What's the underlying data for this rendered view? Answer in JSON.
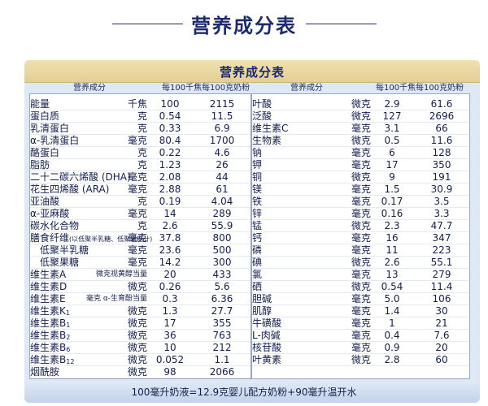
{
  "page_title": "营养成分表",
  "panel_title": "营养成分表",
  "columns": {
    "nutrient": "营养成分",
    "per_100kj": "每100千焦",
    "per_100g": "每100克奶粉"
  },
  "left_rows": [
    {
      "name": "能量",
      "unit": "千焦",
      "a": "100",
      "b": "2115"
    },
    {
      "name": "蛋白质",
      "unit": "克",
      "a": "0.54",
      "b": "11.5"
    },
    {
      "name": "乳清蛋白",
      "unit": "克",
      "a": "0.33",
      "b": "6.9"
    },
    {
      "name": "α-乳清蛋白",
      "unit": "毫克",
      "a": "80.4",
      "b": "1700"
    },
    {
      "name": "酪蛋白",
      "unit": "克",
      "a": "0.22",
      "b": "4.6"
    },
    {
      "name": "脂肪",
      "unit": "克",
      "a": "1.23",
      "b": "26"
    },
    {
      "name": "二十二碳六烯酸 (DHA)",
      "unit": "毫克",
      "a": "2.08",
      "b": "44"
    },
    {
      "name": "花生四烯酸 (ARA)",
      "unit": "毫克",
      "a": "2.88",
      "b": "61"
    },
    {
      "name": "亚油酸",
      "unit": "克",
      "a": "0.19",
      "b": "4.04"
    },
    {
      "name": "α-亚麻酸",
      "unit": "毫克",
      "a": "14",
      "b": "289"
    },
    {
      "name": "碳水化合物",
      "unit": "克",
      "a": "2.6",
      "b": "55.9"
    },
    {
      "name": "膳食纤维",
      "name_note": "(以低聚半乳糖、低聚果糖计)",
      "unit": "毫克",
      "a": "37.8",
      "b": "800"
    },
    {
      "name": "低聚半乳糖",
      "unit": "毫克",
      "a": "23.6",
      "b": "500",
      "indent": true
    },
    {
      "name": "低聚果糖",
      "unit": "毫克",
      "a": "14.2",
      "b": "300",
      "indent": true
    },
    {
      "name": "维生素A",
      "unit": "微克视黄醇当量",
      "a": "20",
      "b": "433"
    },
    {
      "name": "维生素D",
      "unit": "微克",
      "a": "0.26",
      "b": "5.6"
    },
    {
      "name": "维生素E",
      "unit": "毫克 α-生育酚当量",
      "a": "0.3",
      "b": "6.36"
    },
    {
      "name": "维生素K",
      "sub": "1",
      "unit": "微克",
      "a": "1.3",
      "b": "27.7"
    },
    {
      "name": "维生素B",
      "sub": "1",
      "unit": "微克",
      "a": "17",
      "b": "355"
    },
    {
      "name": "维生素B",
      "sub": "2",
      "unit": "微克",
      "a": "36",
      "b": "763"
    },
    {
      "name": "维生素B",
      "sub": "6",
      "unit": "微克",
      "a": "10",
      "b": "212"
    },
    {
      "name": "维生素B",
      "sub": "12",
      "unit": "微克",
      "a": "0.052",
      "b": "1.1"
    },
    {
      "name": "烟酰胺",
      "unit": "微克",
      "a": "98",
      "b": "2066"
    }
  ],
  "right_rows": [
    {
      "name": "叶酸",
      "unit": "微克",
      "a": "2.9",
      "b": "61.6"
    },
    {
      "name": "泛酸",
      "unit": "微克",
      "a": "127",
      "b": "2696"
    },
    {
      "name": "维生素C",
      "unit": "毫克",
      "a": "3.1",
      "b": "66"
    },
    {
      "name": "生物素",
      "unit": "微克",
      "a": "0.5",
      "b": "11.6"
    },
    {
      "name": "钠",
      "unit": "毫克",
      "a": "6",
      "b": "128"
    },
    {
      "name": "钾",
      "unit": "毫克",
      "a": "17",
      "b": "350"
    },
    {
      "name": "铜",
      "unit": "微克",
      "a": "9",
      "b": "191"
    },
    {
      "name": "镁",
      "unit": "毫克",
      "a": "1.5",
      "b": "30.9"
    },
    {
      "name": "铁",
      "unit": "毫克",
      "a": "0.17",
      "b": "3.5"
    },
    {
      "name": "锌",
      "unit": "毫克",
      "a": "0.16",
      "b": "3.3"
    },
    {
      "name": "锰",
      "unit": "微克",
      "a": "2.3",
      "b": "47.7"
    },
    {
      "name": "钙",
      "unit": "毫克",
      "a": "16",
      "b": "347"
    },
    {
      "name": "磷",
      "unit": "毫克",
      "a": "11",
      "b": "223"
    },
    {
      "name": "碘",
      "unit": "微克",
      "a": "2.6",
      "b": "55.1"
    },
    {
      "name": "氯",
      "unit": "毫克",
      "a": "13",
      "b": "279"
    },
    {
      "name": "硒",
      "unit": "微克",
      "a": "0.54",
      "b": "11.4"
    },
    {
      "name": "胆碱",
      "unit": "毫克",
      "a": "5.0",
      "b": "106"
    },
    {
      "name": "肌醇",
      "unit": "毫克",
      "a": "1.4",
      "b": "30"
    },
    {
      "name": "牛磺酸",
      "unit": "毫克",
      "a": "1",
      "b": "21"
    },
    {
      "name": "L-肉碱",
      "unit": "毫克",
      "a": "0.4",
      "b": "7.6"
    },
    {
      "name": "核苷酸",
      "unit": "毫克",
      "a": "0.9",
      "b": "20"
    },
    {
      "name": "叶黄素",
      "unit": "微克",
      "a": "2.8",
      "b": "60"
    }
  ],
  "footnote": "100毫升奶液=12.9克婴儿配方奶粉+90毫升温开水"
}
